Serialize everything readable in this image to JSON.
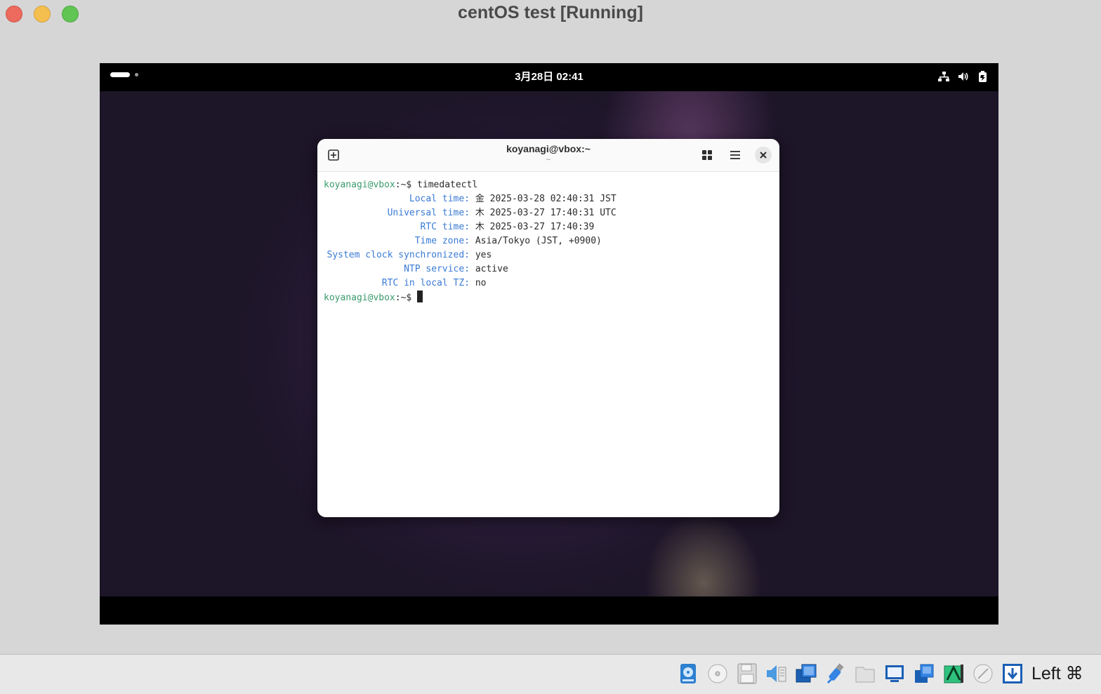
{
  "window": {
    "title": "centOS test [Running]"
  },
  "vm": {
    "clock": "3月28日 02:41",
    "tray_icons": [
      "network-icon",
      "volume-icon",
      "battery-icon"
    ]
  },
  "terminal": {
    "title": "koyanagi@vbox:~",
    "subtitle": "~",
    "prompt1": "koyanagi@vbox",
    "prompt_suffix1": ":~$ ",
    "command": "timedatectl",
    "rows": [
      {
        "label": "Local time:",
        "value": "金 2025-03-28 02:40:31 JST"
      },
      {
        "label": "Universal time:",
        "value": "木 2025-03-27 17:40:31 UTC"
      },
      {
        "label": "RTC time:",
        "value": "木 2025-03-27 17:40:39"
      },
      {
        "label": "Time zone:",
        "value": "Asia/Tokyo (JST, +0900)"
      },
      {
        "label": "System clock synchronized:",
        "value": "yes"
      },
      {
        "label": "NTP service:",
        "value": "active"
      },
      {
        "label": "RTC in local TZ:",
        "value": "no"
      }
    ],
    "prompt2": "koyanagi@vbox",
    "prompt_suffix2": ":~$ "
  },
  "statusbar": {
    "icons": [
      "hard-disk-icon",
      "optical-drive-icon",
      "floppy-icon",
      "audio-icon",
      "network-adapter-icon",
      "usb-icon",
      "shared-folder-icon",
      "display-icon",
      "recording-icon",
      "vt-x-icon",
      "mouse-integration-icon",
      "keyboard-capture-icon"
    ],
    "host_key": "Left ⌘"
  }
}
